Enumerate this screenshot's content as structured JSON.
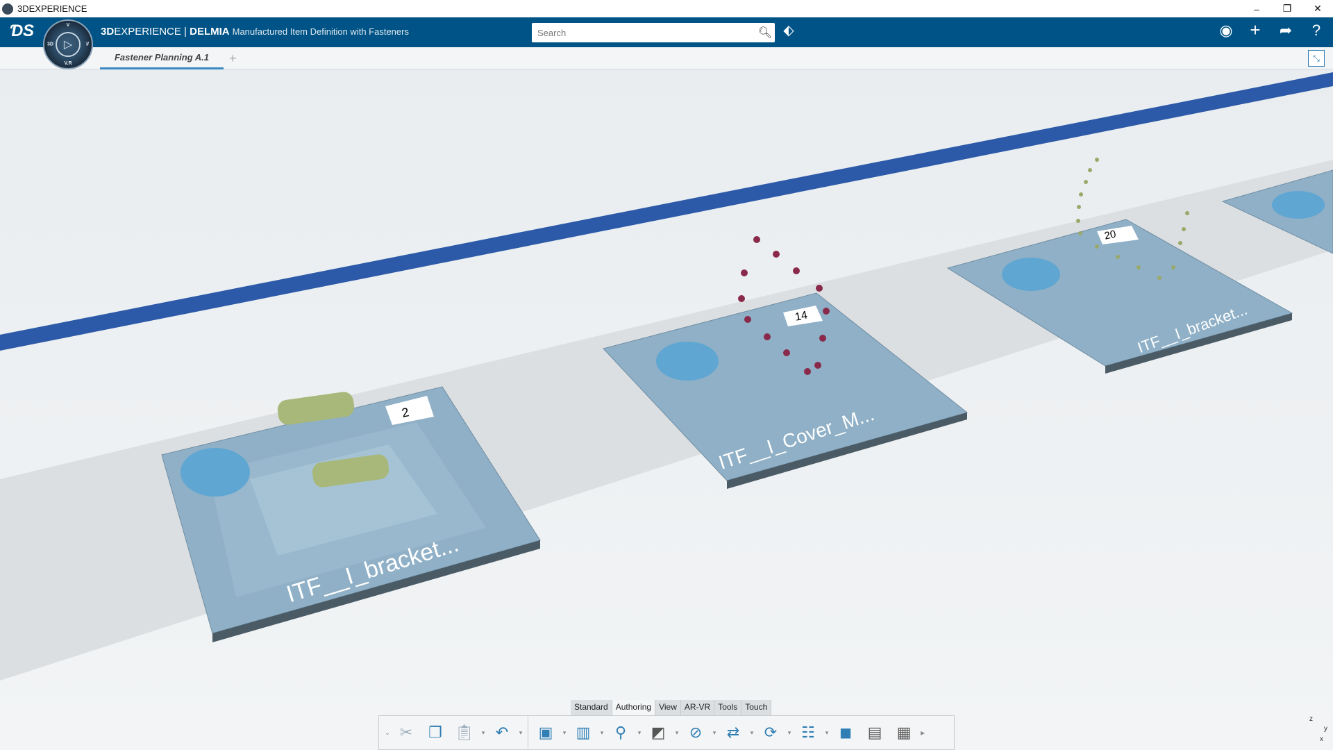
{
  "window": {
    "title": "3DEXPERIENCE",
    "minimize": "–",
    "restore": "❐",
    "close": "✕"
  },
  "header": {
    "brand_3d": "3D",
    "brand_rest": "EXPERIENCE",
    "separator": " | ",
    "brand_app": "DELMIA",
    "subtitle": "Manufactured Item Definition with Fasteners",
    "search_placeholder": "Search",
    "search_value": ""
  },
  "tabs": [
    {
      "label": "Fastener Planning A.1"
    }
  ],
  "tab_add": "+",
  "compass": {
    "top": "V",
    "left": "3D",
    "right": "I/",
    "bottom": "V.R"
  },
  "scene": {
    "pallets": [
      {
        "label": "ITF__I_bracket...",
        "count": "2"
      },
      {
        "label": "ITF__I_Cover_M...",
        "count": "14"
      },
      {
        "label": "ITF__I_bracket...",
        "count": "20"
      }
    ],
    "colors": {
      "rail": "#2c5aa8",
      "pallet": "#8fb0c6",
      "floor": "#dfe3e6"
    }
  },
  "action_bar": {
    "tabs": [
      "Standard",
      "Authoring",
      "View",
      "AR-VR",
      "Tools",
      "Touch"
    ],
    "active_tab": "Authoring",
    "tools": [
      "cut",
      "copy",
      "paste",
      "undo",
      "manufactured-item",
      "assembly",
      "fastener",
      "fastener-definition",
      "boolean",
      "flip",
      "synchronize",
      "structure-sync",
      "3d-view",
      "split-panel",
      "table"
    ]
  },
  "axis": {
    "z": "z",
    "y": "y",
    "x": "x"
  }
}
